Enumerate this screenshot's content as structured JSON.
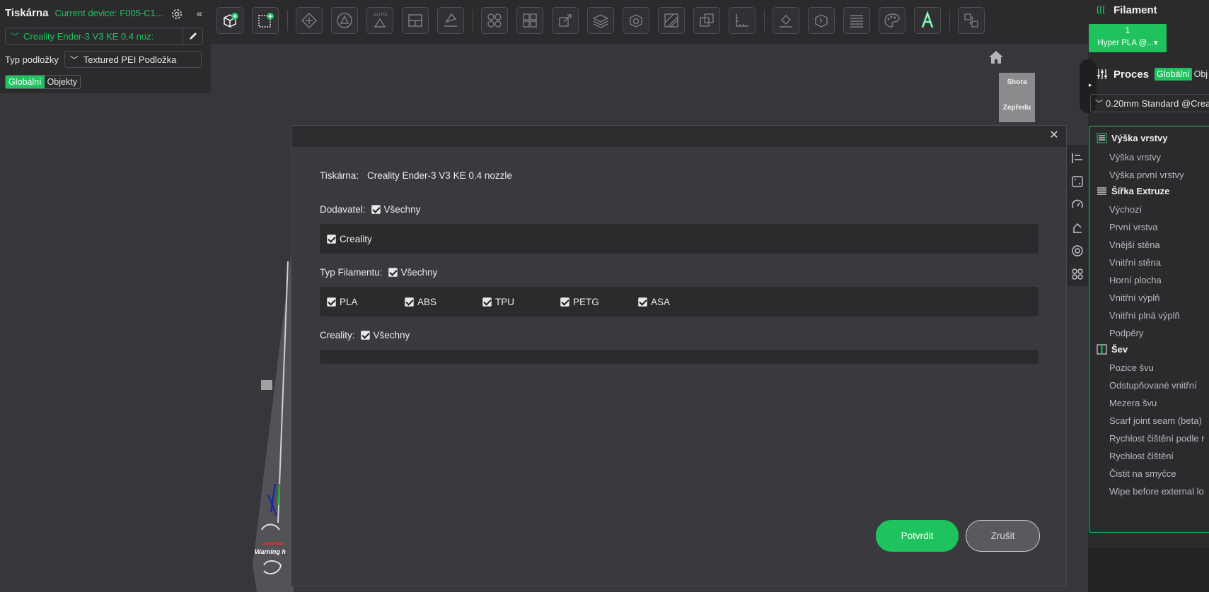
{
  "colors": {
    "accent": "#1fc35e",
    "background": "#37373b",
    "panel": "#2b2b2e"
  },
  "printer_panel": {
    "title": "Tiskárna",
    "current_device": "Current device: F005-C1...",
    "printer_value": "Creality Ender-3 V3 KE 0.4 noz:",
    "bed_label": "Typ podložky",
    "bed_value": "Textured PEI Podložka",
    "tabs": [
      "Globální",
      "Objekty"
    ],
    "icons": {
      "settings": "gear-icon",
      "collapse": "double-chevron-left-icon",
      "edit": "pencil-icon"
    }
  },
  "toolbar": {
    "buttons": [
      "add-cube-icon",
      "add-plate-icon",
      "arrange-icon",
      "orient-icon",
      "auto-orient-icon",
      "split-plate-icon",
      "lay-flat-icon",
      "split-objects-icon",
      "split-parts-icon",
      "scale-icon",
      "layers-icon",
      "cut-icon",
      "mesh-boolean-icon",
      "support-paint-icon",
      "measure-icon",
      "seam-paint-icon",
      "variable-layer-icon",
      "layer-list-icon",
      "color-paint-icon",
      "text-icon",
      "assembly-icon"
    ],
    "auto_label": "AUTO"
  },
  "viewport": {
    "viewcube_top": "Shora",
    "viewcube_front": "Zepředu",
    "warning_text": "Warning h"
  },
  "filament_panel": {
    "title": "Filament",
    "chip_number": "1",
    "chip_name": "Hyper PLA @...▾"
  },
  "process_panel": {
    "title": "Proces",
    "tab_global": "Globální",
    "tab_objects": "Obj",
    "profile": "0.20mm Standard @Crea",
    "sections": [
      {
        "title": "Výška vrstvy",
        "items": [
          "Výška vrstvy",
          "Výška první vrstvy"
        ]
      },
      {
        "title": "Šířka Extruze",
        "items": [
          "Výchozí",
          "První vrstva",
          "Vnější stěna",
          "Vnitřní stěna",
          "Horní plocha",
          "Vnitřní výplň",
          "Vnitřní plná výplň",
          "Podpěry"
        ]
      },
      {
        "title": "Šev",
        "items": [
          "Pozice švu",
          "Odstupňované vnitřní",
          "Mezera švu",
          "Scarf joint seam (beta)",
          "Rychlost čištění podle r",
          "Rychlost čištění",
          "Čistit na smyčce",
          "Wipe before external lo"
        ]
      }
    ]
  },
  "dialog": {
    "printer_label": "Tiskárna:",
    "printer_value": "Creality Ender-3 V3 KE 0.4 nozzle",
    "vendor_label": "Dodavatel:",
    "all_label": "Všechny",
    "vendors": [
      "Creality"
    ],
    "filament_type_label": "Typ Filamentu:",
    "filament_types": [
      "PLA",
      "ABS",
      "TPU",
      "PETG",
      "ASA"
    ],
    "creality_label": "Creality:",
    "confirm": "Potvrdit",
    "cancel": "Zrušit"
  }
}
